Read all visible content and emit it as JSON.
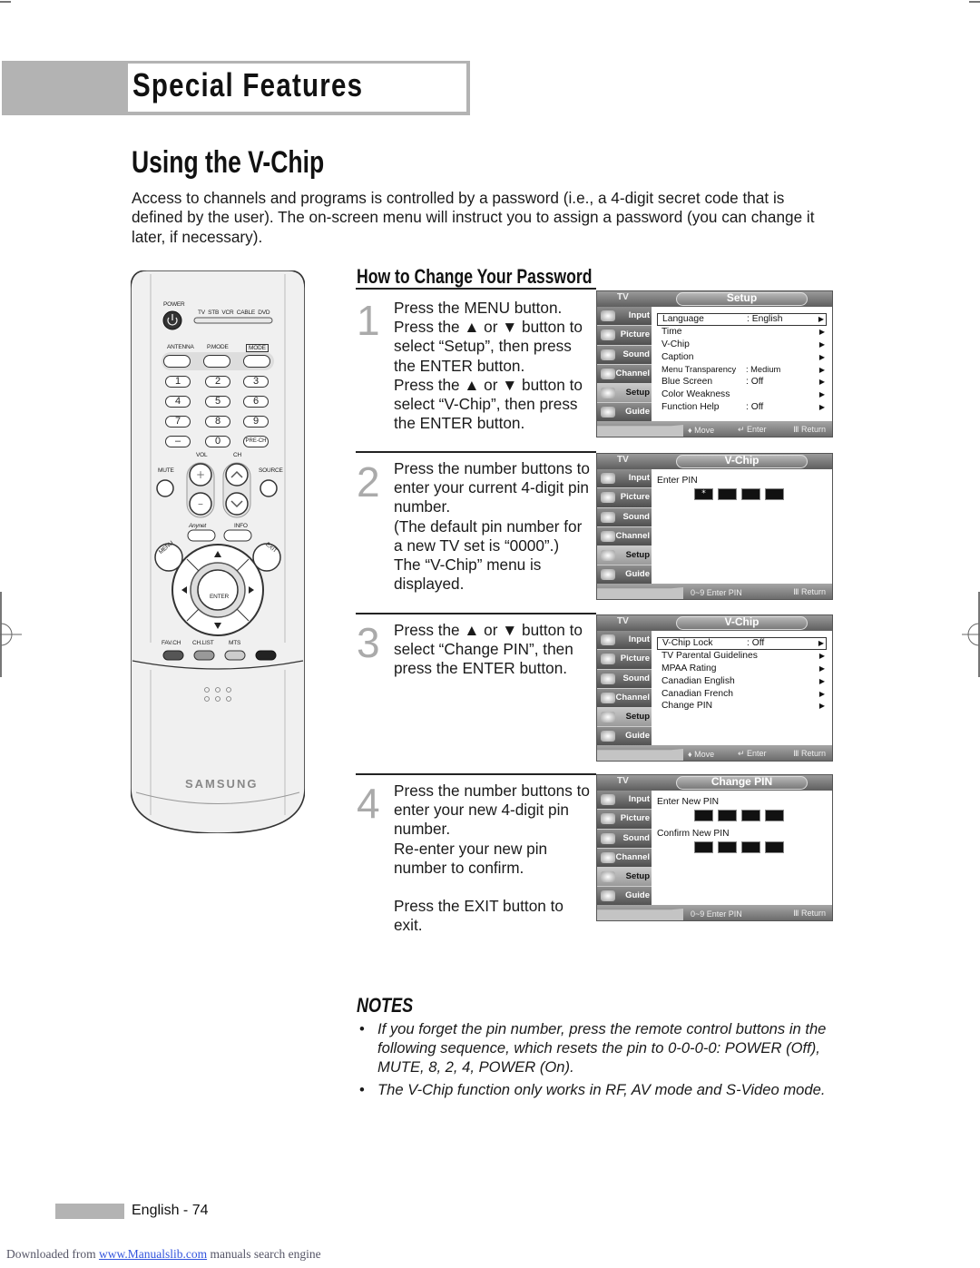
{
  "section": {
    "title": "Special Features"
  },
  "page": {
    "heading": "Using the V-Chip",
    "intro": "Access to channels and programs is controlled by a password (i.e., a 4-digit secret code that is defined by the user). The on-screen menu will instruct you to assign a password (you can change it later, if necessary).",
    "subheading": "How to Change Your Password"
  },
  "steps": [
    {
      "number": "1",
      "lines": [
        "Press the MENU button.",
        "Press the ▲ or ▼ button to select “Setup”, then press the ENTER button.",
        "Press the ▲ or ▼ button to select “V-Chip”, then press the ENTER button."
      ]
    },
    {
      "number": "2",
      "lines": [
        "Press the number buttons to enter your current 4-digit pin number.",
        "(The default pin number for a new TV set is “0000”.)",
        "The “V-Chip” menu is displayed."
      ]
    },
    {
      "number": "3",
      "lines": [
        "Press the ▲ or ▼ button to select “Change PIN”, then press the ENTER button."
      ]
    },
    {
      "number": "4",
      "lines": [
        "Press the number buttons to enter your new 4-digit pin number.",
        "Re-enter your new pin number to confirm.",
        "",
        "Press the EXIT button to exit."
      ]
    }
  ],
  "osd_common": {
    "tv_label": "TV",
    "sidebar": [
      "Input",
      "Picture",
      "Sound",
      "Channel",
      "Setup",
      "Guide"
    ],
    "active_sidebar": "Setup",
    "hint_move": "♦ Move",
    "hint_enter": "↵ Enter",
    "hint_return": "Ⅲ Return",
    "hint_enter_pin": "0~9 Enter PIN"
  },
  "osd_screens": [
    {
      "title": "Setup",
      "rows": [
        {
          "label": "Language",
          "value": ": English",
          "selected": true
        },
        {
          "label": "Time",
          "value": ""
        },
        {
          "label": "V-Chip",
          "value": ""
        },
        {
          "label": "Caption",
          "value": ""
        },
        {
          "label": "Menu Transparency",
          "value": ": Medium",
          "small": true
        },
        {
          "label": "Blue Screen",
          "value": ": Off"
        },
        {
          "label": "Color Weakness",
          "value": ""
        },
        {
          "label": "Function Help",
          "value": ": Off"
        }
      ]
    },
    {
      "title": "V-Chip",
      "pin_label": "Enter PIN",
      "pin": [
        "*",
        "",
        "",
        ""
      ]
    },
    {
      "title": "V-Chip",
      "rows": [
        {
          "label": "V-Chip Lock",
          "value": ": Off",
          "selected": true
        },
        {
          "label": "TV Parental Guidelines",
          "value": ""
        },
        {
          "label": "MPAA Rating",
          "value": ""
        },
        {
          "label": "Canadian English",
          "value": ""
        },
        {
          "label": "Canadian French",
          "value": ""
        },
        {
          "label": "Change PIN",
          "value": ""
        }
      ]
    },
    {
      "title": "Change PIN",
      "pin_label": "Enter New PIN",
      "pin": [
        "",
        "",
        "",
        ""
      ],
      "pin_label2": "Confirm New PIN",
      "pin2": [
        "",
        "",
        "",
        ""
      ]
    }
  ],
  "remote": {
    "power": "POWER",
    "modes": "TV  STB  VCR  CABLE  DVD",
    "antenna": "ANTENNA",
    "pmode": "P.MODE",
    "mode": "MODE",
    "digits": [
      "1",
      "2",
      "3",
      "4",
      "5",
      "6",
      "7",
      "8",
      "9",
      "–",
      "0",
      "PRE-CH"
    ],
    "vol": "VOL",
    "ch": "CH",
    "mute": "MUTE",
    "source": "SOURCE",
    "anynet": "Anynet",
    "info": "INFO",
    "menu": "MENU",
    "exit": "EXIT",
    "enter": "ENTER",
    "favch": "FAV.CH",
    "chlist": "CH.LIST",
    "mts": "MTS",
    "brand": "SAMSUNG"
  },
  "notes": {
    "title": "NOTES",
    "items": [
      "If you forget the pin number, press the remote control buttons in the following sequence, which resets the pin to 0-0-0-0: POWER (Off), MUTE, 8, 2, 4, POWER (On).",
      "The V-Chip function only works in RF, AV mode and S-Video mode."
    ]
  },
  "footer": {
    "page_label": "English - 74",
    "download_prefix": "Downloaded from ",
    "download_link": "www.Manualslib.com",
    "download_suffix": " manuals search engine"
  }
}
